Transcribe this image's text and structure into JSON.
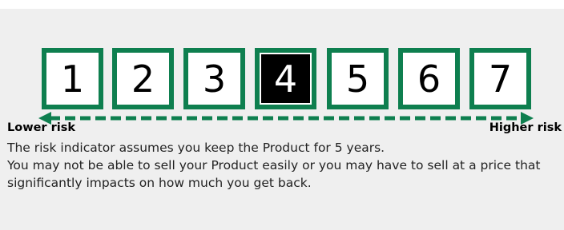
{
  "risk_indicator": {
    "levels": [
      "1",
      "2",
      "3",
      "4",
      "5",
      "6",
      "7"
    ],
    "selected_level": "4",
    "lower_label": "Lower risk",
    "higher_label": "Higher risk"
  },
  "description": {
    "line1": "The risk indicator assumes you keep the Product for 5 years.",
    "line2": "You may not be able to sell your Product easily or you may have to sell at a price that significantly impacts on how much you get back."
  },
  "colors": {
    "accent": "#0e7f4f",
    "selected_fill": "#000000",
    "panel_background": "#efefef"
  }
}
